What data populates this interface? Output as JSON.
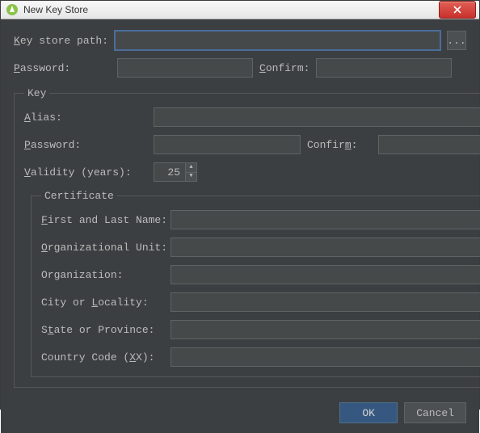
{
  "window": {
    "title": "New Key Store"
  },
  "keystore": {
    "path_label_pre": "K",
    "path_label_post": "ey store path:",
    "path_value": "",
    "browse": "...",
    "password_label_pre": "P",
    "password_label_post": "assword:",
    "password_value": "",
    "confirm_label_pre": "C",
    "confirm_label_post": "onfirm:",
    "confirm_value": ""
  },
  "key": {
    "legend": "Key",
    "alias_label_pre": "A",
    "alias_label_post": "lias:",
    "alias_value": "",
    "password_label_pre": "P",
    "password_label_post": "assword:",
    "password_value": "",
    "confirm_label_pre": "Confir",
    "confirm_label_mid": "m",
    "confirm_label_post": ":",
    "confirm_value": "",
    "validity_label_pre": "V",
    "validity_label_post": "alidity (years):",
    "validity_value": "25"
  },
  "cert": {
    "legend": "Certificate",
    "first_label_pre": "F",
    "first_label_post": "irst and Last Name:",
    "first_value": "",
    "ou_label_pre": "O",
    "ou_label_post": "rganizational Unit:",
    "ou_value": "",
    "org_label": "Organization:",
    "org_value": "",
    "city_label_pre": "City or ",
    "city_label_mid": "L",
    "city_label_post": "ocality:",
    "city_value": "",
    "state_label_pre": "S",
    "state_label_mid": "t",
    "state_label_post": "ate or Province:",
    "state_value": "",
    "cc_label_pre": "Country Code (",
    "cc_label_mid": "X",
    "cc_label_post": "X):",
    "cc_value": ""
  },
  "footer": {
    "ok": "OK",
    "cancel": "Cancel"
  }
}
